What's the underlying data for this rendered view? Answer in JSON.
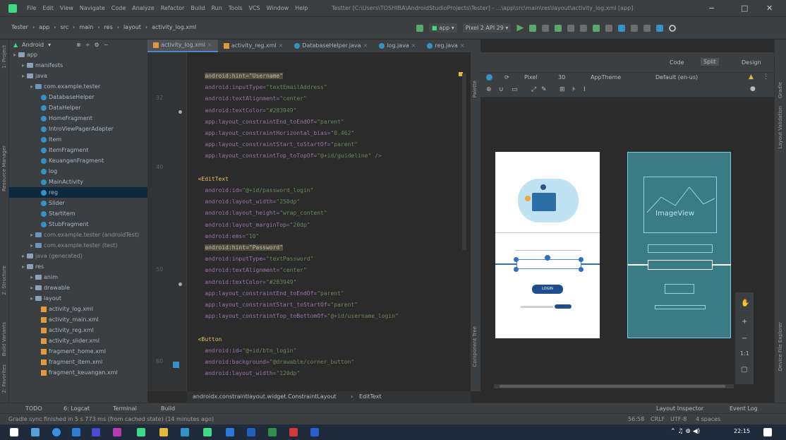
{
  "menu": [
    "File",
    "Edit",
    "View",
    "Navigate",
    "Code",
    "Analyze",
    "Refactor",
    "Build",
    "Run",
    "Tools",
    "VCS",
    "Window",
    "Help"
  ],
  "window_title": "Testter [C:\\Users\\TOSHIBA\\AndroidStudioProjects\\Tester] - ...\\app\\src\\main\\res\\layout\\activity_log.xml [app]",
  "nav": {
    "crumbs": [
      "Tester",
      "app",
      "src",
      "main",
      "res",
      "layout",
      "activity_log.xml"
    ],
    "run_config": "app",
    "device": "Pixel 2 API 29"
  },
  "project": {
    "dropdown": "Android",
    "items": [
      {
        "label": "app",
        "depth": 0,
        "kind": "dir"
      },
      {
        "label": "manifests",
        "depth": 1,
        "kind": "dir"
      },
      {
        "label": "java",
        "depth": 1,
        "kind": "dir"
      },
      {
        "label": "com.example.tester",
        "depth": 2,
        "kind": "pkg"
      },
      {
        "label": "DatabaseHelper",
        "depth": 3,
        "kind": "cls"
      },
      {
        "label": "DataHelper",
        "depth": 3,
        "kind": "cls"
      },
      {
        "label": "HomeFragment",
        "depth": 3,
        "kind": "cls"
      },
      {
        "label": "IntroViewPagerAdapter",
        "depth": 3,
        "kind": "cls"
      },
      {
        "label": "Item",
        "depth": 3,
        "kind": "cls"
      },
      {
        "label": "ItemFragment",
        "depth": 3,
        "kind": "cls"
      },
      {
        "label": "KeuanganFragment",
        "depth": 3,
        "kind": "cls"
      },
      {
        "label": "log",
        "depth": 3,
        "kind": "cls"
      },
      {
        "label": "MainActivity",
        "depth": 3,
        "kind": "cls"
      },
      {
        "label": "reg",
        "depth": 3,
        "kind": "cls",
        "selected": true
      },
      {
        "label": "Slider",
        "depth": 3,
        "kind": "cls"
      },
      {
        "label": "Startitem",
        "depth": 3,
        "kind": "cls"
      },
      {
        "label": "StubFragment",
        "depth": 3,
        "kind": "cls"
      },
      {
        "label": "com.example.tester (androidTest)",
        "depth": 2,
        "kind": "pkg",
        "dim": true
      },
      {
        "label": "com.example.tester (test)",
        "depth": 2,
        "kind": "pkg",
        "dim": true
      },
      {
        "label": "java (generated)",
        "depth": 1,
        "kind": "dir",
        "dim": true
      },
      {
        "label": "res",
        "depth": 1,
        "kind": "dir"
      },
      {
        "label": "anim",
        "depth": 2,
        "kind": "dir"
      },
      {
        "label": "drawable",
        "depth": 2,
        "kind": "dir"
      },
      {
        "label": "layout",
        "depth": 2,
        "kind": "dir"
      },
      {
        "label": "activity_log.xml",
        "depth": 3,
        "kind": "xml"
      },
      {
        "label": "activity_main.xml",
        "depth": 3,
        "kind": "xml"
      },
      {
        "label": "activity_reg.xml",
        "depth": 3,
        "kind": "xml"
      },
      {
        "label": "activity_slider.xml",
        "depth": 3,
        "kind": "xml"
      },
      {
        "label": "fragment_home.xml",
        "depth": 3,
        "kind": "xml"
      },
      {
        "label": "fragment_item.xml",
        "depth": 3,
        "kind": "xml"
      },
      {
        "label": "fragment_keuangan.xml",
        "depth": 3,
        "kind": "xml"
      }
    ]
  },
  "tabs": [
    {
      "label": "activity_log.xml",
      "active": true
    },
    {
      "label": "activity_reg.xml"
    },
    {
      "label": "DatabaseHelper.java"
    },
    {
      "label": "log.java"
    },
    {
      "label": "reg.java"
    }
  ],
  "line_numbers": [
    "",
    "",
    "32",
    "",
    "",
    "",
    "",
    "",
    "40",
    "",
    "",
    "",
    "",
    "",
    "",
    "",
    "",
    "50",
    "",
    "",
    "",
    "",
    "",
    "",
    "",
    "60",
    ""
  ],
  "code": [
    {
      "p": [
        [
          "    ",
          ""
        ],
        [
          "android:hint=\"Username\"",
          "hl"
        ]
      ]
    },
    {
      "p": [
        [
          "    android:inputType=",
          "attr"
        ],
        [
          "\"textEmailAddress\"",
          "val"
        ]
      ]
    },
    {
      "p": [
        [
          "    android:textAlignment=",
          "attr"
        ],
        [
          "\"center\"",
          "val"
        ]
      ]
    },
    {
      "p": [
        [
          "    android:textColor=",
          "attr"
        ],
        [
          "\"#283949\"",
          "val"
        ]
      ]
    },
    {
      "p": [
        [
          "    app:layout_constraintEnd_toEndOf=",
          "attr"
        ],
        [
          "\"parent\"",
          "val"
        ]
      ]
    },
    {
      "p": [
        [
          "    app:layout_constraintHorizontal_bias=",
          "attr"
        ],
        [
          "\"0.462\"",
          "val"
        ]
      ]
    },
    {
      "p": [
        [
          "    app:layout_constraintStart_toStartOf=",
          "attr"
        ],
        [
          "\"parent\"",
          "val"
        ]
      ]
    },
    {
      "p": [
        [
          "    app:layout_constraintTop_toTopOf=",
          "attr"
        ],
        [
          "\"@+id/guideline\" />",
          "val"
        ]
      ]
    },
    {
      "p": [
        [
          "",
          ""
        ]
      ]
    },
    {
      "p": [
        [
          "  ",
          ""
        ],
        [
          "<EditText",
          "tag"
        ]
      ]
    },
    {
      "p": [
        [
          "    android:id=",
          "attr"
        ],
        [
          "\"@+id/password_login\"",
          "val"
        ]
      ]
    },
    {
      "p": [
        [
          "    android:layout_width=",
          "attr"
        ],
        [
          "\"250dp\"",
          "val"
        ]
      ]
    },
    {
      "p": [
        [
          "    android:layout_height=",
          "attr"
        ],
        [
          "\"wrap_content\"",
          "val"
        ]
      ]
    },
    {
      "p": [
        [
          "    android:layout_marginTop=",
          "attr"
        ],
        [
          "\"20dp\"",
          "val"
        ]
      ]
    },
    {
      "p": [
        [
          "    android:ems=",
          "attr"
        ],
        [
          "\"10\"",
          "val"
        ]
      ]
    },
    {
      "p": [
        [
          "    ",
          ""
        ],
        [
          "android:hint=\"Password\"",
          "hl"
        ]
      ]
    },
    {
      "p": [
        [
          "    android:inputType=",
          "attr"
        ],
        [
          "\"textPassword\"",
          "val"
        ]
      ]
    },
    {
      "p": [
        [
          "    android:textAlignment=",
          "attr"
        ],
        [
          "\"center\"",
          "val"
        ]
      ]
    },
    {
      "p": [
        [
          "    android:textColor=",
          "attr"
        ],
        [
          "\"#283949\"",
          "val"
        ]
      ]
    },
    {
      "p": [
        [
          "    app:layout_constraintEnd_toEndOf=",
          "attr"
        ],
        [
          "\"parent\"",
          "val"
        ]
      ]
    },
    {
      "p": [
        [
          "    app:layout_constraintStart_toStartOf=",
          "attr"
        ],
        [
          "\"parent\"",
          "val"
        ]
      ]
    },
    {
      "p": [
        [
          "    app:layout_constraintTop_toBottomOf=",
          "attr"
        ],
        [
          "\"@+id/username_login\"",
          "val"
        ]
      ]
    },
    {
      "p": [
        [
          "",
          ""
        ]
      ]
    },
    {
      "p": [
        [
          "  ",
          ""
        ],
        [
          "<Button",
          "tag"
        ]
      ]
    },
    {
      "p": [
        [
          "    android:id=",
          "attr"
        ],
        [
          "\"@+id/btn_login\"",
          "val"
        ]
      ]
    },
    {
      "p": [
        [
          "    android:background=",
          "attr"
        ],
        [
          "\"@drawable/corner_button\"",
          "val"
        ]
      ]
    },
    {
      "p": [
        [
          "    android:layout_width=",
          "attr"
        ],
        [
          "\"120dp\"",
          "val"
        ]
      ]
    }
  ],
  "editor_crumb": [
    "androidx.constraintlayout.widget.ConstraintLayout",
    "EditText"
  ],
  "design": {
    "modes": [
      "Code",
      "Split",
      "Design"
    ],
    "toolbar": [
      "Pixel",
      "30",
      "AppTheme",
      "Default (en-us)"
    ],
    "blueprint_label": "ImageView",
    "phone_login_label": "LOGIN"
  },
  "side_labels": {
    "left": [
      "1: Project",
      "Resource Manager",
      "2: Structure",
      "Build Variants",
      "2: Favorites"
    ],
    "right": [
      "Gradle",
      "Layout Validation",
      "Device File Explorer"
    ],
    "palette": "Palette",
    "component_tree": "Component Tree"
  },
  "bottom_tools": [
    "TODO",
    "6: Logcat",
    "Terminal",
    "Build"
  ],
  "bottom_right_tools": [
    "Layout Inspector",
    "Event Log"
  ],
  "status": {
    "message": "Gradle sync finished in 5 s 773 ms (from cached state) (14 minutes ago)",
    "right": [
      "56:58",
      "CRLF",
      "UTF-8",
      "4 spaces"
    ]
  },
  "taskbar_time": "22:15",
  "colors": {
    "accent": "#4a88c7",
    "blueprint": "#3a7b85",
    "selection": "#0d293e"
  }
}
